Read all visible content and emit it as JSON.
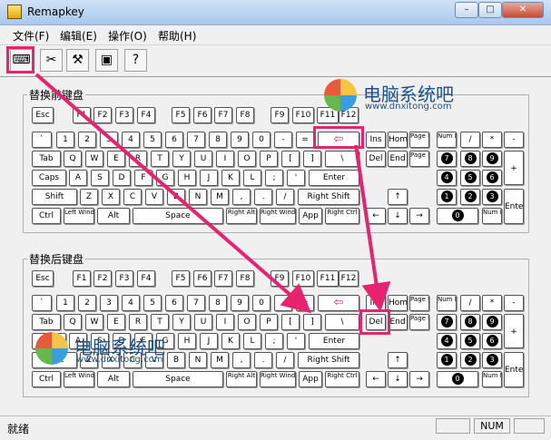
{
  "window": {
    "title": "Remapkey",
    "controls": [
      "–",
      "□",
      "✕"
    ]
  },
  "menu": [
    "文件(F)",
    "编辑(E)",
    "操作(O)",
    "帮助(H)"
  ],
  "toolbar": [
    {
      "name": "open-keyboard-icon",
      "glyph": "⌨"
    },
    {
      "name": "reset-icon",
      "glyph": "✂"
    },
    {
      "name": "hammer-icon",
      "glyph": "⚒"
    },
    {
      "name": "preview-icon",
      "glyph": "▣"
    },
    {
      "name": "help-icon",
      "glyph": "?"
    }
  ],
  "groups": {
    "base": "替换前键盘",
    "remap": "替换后键盘"
  },
  "statusbar": {
    "text": "就绪",
    "num": "NUM"
  },
  "watermark": {
    "cn": "电脑系统吧",
    "url": "www.dnxitong.com"
  },
  "accent": "#e8226e",
  "keys": {
    "esc": "Esc",
    "f1": "F1",
    "f2": "F2",
    "f3": "F3",
    "f4": "F4",
    "f5": "F5",
    "f6": "F6",
    "f7": "F7",
    "f8": "F8",
    "f9": "F9",
    "f10": "F10",
    "f11": "F11",
    "f12": "F12",
    "grave": "`",
    "k1": "1",
    "k2": "2",
    "k3": "3",
    "k4": "4",
    "k5": "5",
    "k6": "6",
    "k7": "7",
    "k8": "8",
    "k9": "9",
    "k0": "0",
    "minus": "-",
    "equal": "=",
    "back": "⇦",
    "tab": "Tab",
    "q": "Q",
    "w": "W",
    "e": "E",
    "r": "R",
    "t": "T",
    "y": "Y",
    "u": "U",
    "i": "I",
    "o": "O",
    "p": "P",
    "lbr": "[",
    "rbr": "]",
    "bslash": "\\",
    "caps": "Caps",
    "a": "A",
    "s": "S",
    "d": "D",
    "f": "F",
    "g": "G",
    "h": "H",
    "j": "J",
    "k": "K",
    "l": "L",
    "semi": ";",
    "quote": "'",
    "enter": "Enter",
    "shift": "Shift",
    "z": "Z",
    "x": "X",
    "c": "C",
    "v": "V",
    "b": "B",
    "n": "N",
    "m": "M",
    "comma": ",",
    "period": ".",
    "slash": "/",
    "rshift": "Right Shift",
    "ctrl": "Ctrl",
    "lwin": "Left Windows",
    "alt": "Alt",
    "space": "Space",
    "ralt": "Right Alt",
    "rwin": "Right Windows",
    "app": "App",
    "rctrl": "Right Ctrl",
    "ins": "Ins",
    "home": "Home",
    "pgup": "Page Up",
    "del": "Del",
    "end": "End",
    "pgdn": "Page Down",
    "up": "↑",
    "left": "←",
    "down": "↓",
    "right": "→",
    "numlock": "Num Lock",
    "ndiv": "/",
    "nmul": "*",
    "nminus": "-",
    "nplus": "+",
    "nenter": "Enter",
    "n7": "7",
    "n8": "8",
    "n9": "9",
    "n4": "4",
    "n5": "5",
    "n6": "6",
    "n1": "1",
    "n2": "2",
    "n3": "3",
    "n0": "0",
    "ndel": "Num Del"
  }
}
